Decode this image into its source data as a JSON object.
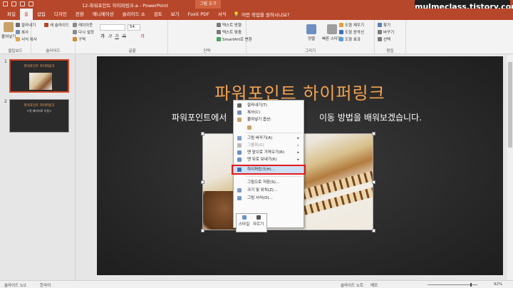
{
  "window": {
    "document_title": "12-파워포인트 하이퍼링크-a - PowerPoint",
    "context_tab_group": "그림 도구",
    "banner": "mulmeclass.tistory.com"
  },
  "tabs": [
    "파일",
    "홈",
    "삽입",
    "디자인",
    "전환",
    "애니메이션",
    "슬라이드 쇼",
    "검토",
    "보기",
    "Foxit PDF",
    "서식"
  ],
  "active_tab": "홈",
  "tell_me": "어떤 작업을 원하시나요?",
  "ribbon": {
    "clipboard": {
      "label": "클립보드",
      "paste": "붙여넣기",
      "cut": "잘라내기",
      "copy": "복사",
      "format_painter": "서식 복사"
    },
    "slides": {
      "label": "슬라이드",
      "new_slide": "새 슬라이드",
      "layout": "레이아웃",
      "reset": "다시 설정",
      "section": "구역"
    },
    "font": {
      "label": "글꼴",
      "font_size": "54"
    },
    "paragraph": {
      "label": "단락",
      "text_direction": "텍스트 방향",
      "align_text": "텍스트 맞춤",
      "smartart": "SmartArt로 변환"
    },
    "drawing": {
      "label": "그리기",
      "arrange": "정렬",
      "quick_styles": "빠른 스타일",
      "shape_fill": "도형 채우기",
      "shape_outline": "도형 윤곽선",
      "shape_effects": "도형 효과"
    },
    "editing": {
      "label": "편집",
      "find": "찾기",
      "replace": "바꾸기",
      "select": "선택"
    }
  },
  "thumbnails": [
    {
      "num": "1",
      "title": "파워포인트 하이퍼링크",
      "subtitle": ""
    },
    {
      "num": "2",
      "title": "파워포인트 하이퍼링크",
      "subtitle": "<첫 페이지로 이동>"
    }
  ],
  "slide": {
    "title": "파워포인트 하이퍼링크",
    "subtitle_left": "파워포인트에서",
    "subtitle_right": "이동 방법을 배워보겠습니다."
  },
  "context_menu": {
    "items": [
      {
        "label": "잘라내기(T)",
        "disabled": false
      },
      {
        "label": "복사(C)",
        "disabled": false
      },
      {
        "label": "붙여넣기 옵션:",
        "disabled": false
      },
      {
        "label": "",
        "disabled": false
      },
      {
        "label": "그림 바꾸기(A)",
        "disabled": false,
        "submenu": true
      },
      {
        "label": "그룹화(G)",
        "disabled": true,
        "submenu": true
      },
      {
        "label": "맨 앞으로 가져오기(R)",
        "disabled": false,
        "submenu": true
      },
      {
        "label": "맨 뒤로 보내기(K)",
        "disabled": false,
        "submenu": true
      },
      {
        "label": "하이퍼링크(H)...",
        "disabled": false
      },
      {
        "label": "그림으로 저장(S)...",
        "disabled": false
      },
      {
        "label": "크기 및 위치(Z)...",
        "disabled": false
      },
      {
        "label": "그림 서식(O)...",
        "disabled": false
      }
    ]
  },
  "mini_toolbar": {
    "style": "스타일",
    "crop": "자르기"
  },
  "statusbar": {
    "slide_info": "슬라이드 1/2",
    "language": "한국어",
    "notes": "슬라이드 노트",
    "comments": "메모",
    "zoom": "92%"
  },
  "colors": {
    "accent": "#b7472a",
    "title": "#f4a352",
    "highlight_box": "#e21c1c"
  }
}
